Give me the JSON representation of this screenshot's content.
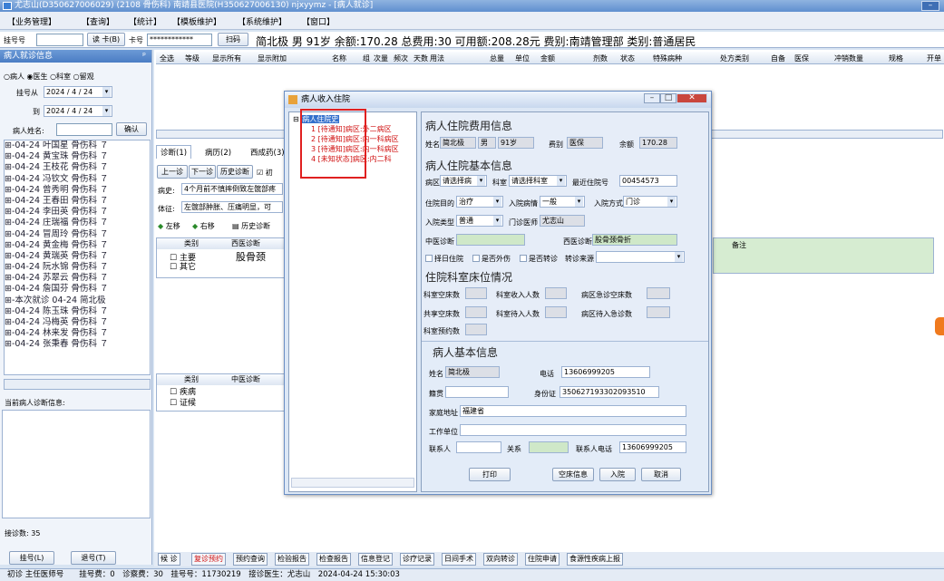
{
  "title": "尤志山(D350627006029) (2108 骨伤科) 南靖县医院(H350627006130) njxyymz - [病人就诊]",
  "menu": [
    "【业务管理】",
    "【查询】",
    "【统计】",
    "【模板维护】",
    "【系统维护】",
    "【窗口】"
  ],
  "info": {
    "reg_label": "挂号号",
    "card_btn": "读 卡(B)",
    "card_label": "卡号",
    "card_value": "************",
    "scan_btn": "扫码",
    "patient_summary": "简北极 男 91岁 余额:170.28 总费用:30 可用额:208.28元 费别:南靖管理部 类别:普通居民"
  },
  "left": {
    "header": "病人就诊信息",
    "pin": "ᵖ",
    "radio": [
      "病人",
      "医生",
      "科室",
      "留观"
    ],
    "date_from_label": "挂号从",
    "date_from": "2024 / 4 / 24",
    "date_to_label": "到",
    "date_to": "2024 / 4 / 24",
    "name_label": "病人姓名:",
    "confirm_btn": "确认",
    "tree": [
      "⊞-04-24 叶国星 骨伤科 ７",
      "⊞-04-24 黄宝珠 骨伤科 ７",
      "⊞-04-24 王枝花 骨伤科 ７",
      "⊞-04-24 冯钦文 骨伤科 ７",
      "⊞-04-24 曾秀明 骨伤科 ７",
      "⊞-04-24 王春田 骨伤科 ７",
      "⊞-04-24 李田英 骨伤科 ７",
      "⊞-04-24 庄瑞福 骨伤科 ７",
      "⊞-04-24 冒周玲 骨伤科 ７",
      "⊞-04-24 黄金梅 骨伤科 ７",
      "⊞-04-24 黄瑞英 骨伤科 ７",
      "⊞-04-24 阮水锦 骨伤科 ７",
      "⊞-04-24 苏翠云 骨伤科 ７",
      "⊞-04-24 詹国芬 骨伤科 ７",
      "⊞-本次就诊 04-24 简北极",
      "⊞-04-24 陈玉珠 骨伤科 ７",
      "⊞-04-24 冯梅英 骨伤科 ７",
      "⊞-04-24 林来发 骨伤科 ７",
      "⊞-04-24 张秉春 骨伤科 ７"
    ],
    "current_label": "当前病人诊断信息:",
    "count": "接诊数: 35",
    "reg_btn": "挂号(L)",
    "cancel_btn": "退号(T)"
  },
  "grid_headers": [
    "全选",
    "等级",
    "显示所有",
    "显示附加",
    "名称",
    "组",
    "次量",
    "频次",
    "天数",
    "用法",
    "总量",
    "单位",
    "金额",
    "剂数",
    "状态",
    "特殊病种",
    "处方类别",
    "自备",
    "医保",
    "冲销数量",
    "规格",
    "开单"
  ],
  "tabs": [
    "诊断(1)",
    "病历(2)",
    "西成药(3)"
  ],
  "toolbar": [
    "上一诊",
    "下一诊",
    "历史诊断",
    "初"
  ],
  "history": {
    "label": "病史:",
    "value": "4个月前不慎摔倒致左髋部疼"
  },
  "exam": {
    "label": "体征:",
    "value": "左髋部肿胀、压痛明显，可"
  },
  "move": [
    "左移",
    "右移",
    "历史诊断"
  ],
  "diag_table": {
    "h_type": "类别",
    "h_west": "西医诊断",
    "rows": [
      "主要",
      "其它"
    ],
    "west": "股骨颈",
    "note_header": "备注"
  },
  "diag_table2": {
    "h_type": "类别",
    "h_cn": "中医诊断",
    "rows": [
      "疾病",
      "证候"
    ]
  },
  "bottom": [
    "候 诊",
    "复诊预约",
    "预约查询",
    "检验报告",
    "检查报告",
    "信息登记",
    "诊疗记录",
    "日间手术",
    "双向转诊",
    "住院申请",
    "食源性疾病上报"
  ],
  "status": "初诊 主任医师号　　挂号费：0　诊察费：30　挂号号：11730219　接诊医生：尤志山　2024-04-24 15:30:03",
  "dialog": {
    "title": "病人收入住院",
    "tree_root": "病人住院史",
    "tree_items": [
      "1 [待通知]病区:外二病区",
      "2 [待通知]病区:内一科病区",
      "3 [待通知]病区:内一科病区",
      "4 [未知状态]病区:内二科"
    ],
    "fee_section": "病人住院费用信息",
    "name_label": "姓名",
    "name": "简北极",
    "sex": "男",
    "age": "91岁",
    "fee_type_label": "费别",
    "fee_type": "医保",
    "balance_label": "余额",
    "balance": "170.28",
    "basic_section": "病人住院基本信息",
    "ward_label": "病区",
    "ward": "请选择病",
    "dept_label": "科室",
    "dept": "请选择科室",
    "recent_label": "最近住院号",
    "recent": "00454573",
    "purpose_label": "住院目的",
    "purpose": "治疗",
    "condition_label": "入院病情",
    "condition": "一般",
    "method_label": "入院方式",
    "method": "门诊",
    "type_label": "入院类型",
    "type": "普通",
    "doctor_label": "门诊医师",
    "doctor": "尤志山",
    "cn_diag_label": "中医诊断",
    "west_diag_label": "西医诊断",
    "west_diag": "股骨颈骨折",
    "chk": [
      "择日住院",
      "是否外伤",
      "是否转诊"
    ],
    "source_label": "转诊来源",
    "bed_section": "住院科室床位情况",
    "bed_labels": [
      "科室空床数",
      "科室收入人数",
      "病区急诊空床数",
      "共享空床数",
      "科室待入人数",
      "病区待入急诊数",
      "科室预约数"
    ],
    "pinfo_section": "病人基本信息",
    "p_name_label": "姓名",
    "p_name": "简北极",
    "phone_label": "电话",
    "phone": "13606999205",
    "origin_label": "籍贯",
    "id_label": "身份证",
    "id": "350627193302093510",
    "addr_label": "家庭地址",
    "addr": "福建省",
    "work_label": "工作单位",
    "contact_label": "联系人",
    "rel_label": "关系",
    "cphone_label": "联系人电话",
    "cphone": "13606999205",
    "buttons": [
      "打印",
      "空床信息",
      "入院",
      "取消"
    ]
  }
}
